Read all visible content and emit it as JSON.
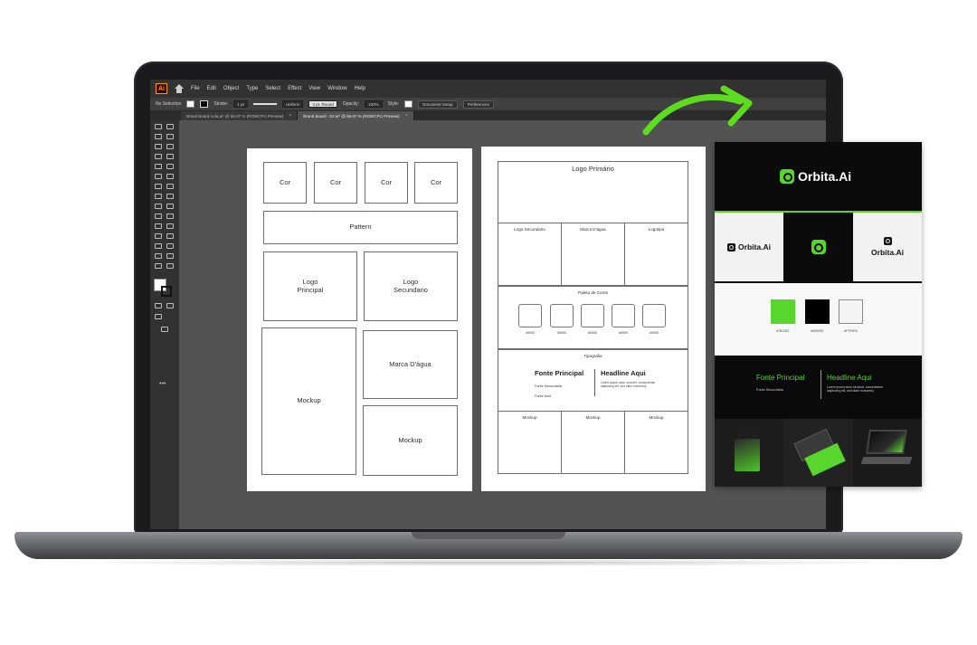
{
  "app": {
    "menu": [
      "File",
      "Edit",
      "Object",
      "Type",
      "Select",
      "Effect",
      "View",
      "Window",
      "Help"
    ],
    "logo_text": "Ai"
  },
  "control_bar": {
    "selection": "No Selection",
    "stroke_label": "Stroke:",
    "stroke_weight": "1 pt",
    "uniform": "Uniform",
    "brush": "3 pt. Round",
    "opacity_label": "Opacity:",
    "opacity_value": "100%",
    "style_label": "Style:",
    "document_setup": "Document Setup",
    "preferences": "Preferences"
  },
  "tabs": [
    {
      "label": "Brand Board Aula.ai* @ 66.67 % (RGB/CPU Preview)",
      "active": false
    },
    {
      "label": "Brand Board - 02.ai* @ 66.67 % (RGB/CPU Preview)",
      "active": true
    }
  ],
  "artboard1": {
    "cor": [
      "Cor",
      "Cor",
      "Cor",
      "Cor"
    ],
    "pattern": "Pattern",
    "logo_principal": "Logo\nPrincipal",
    "logo_secundario": "Logo\nSecundario",
    "mockup_large": "Mockup",
    "marca_dagua": "Marca D'água",
    "mockup_small": "Mockup"
  },
  "artboard2": {
    "logo_primario": "Logo Primário",
    "logo_secundario": "Logo Secundario",
    "marca_dagua": "Marca D'água",
    "logotipo": "Logotipo",
    "paleta": "Paleta de Cores",
    "hexes": [
      "#0000",
      "#0000",
      "#0000",
      "#0000",
      "#0000"
    ],
    "tipografia": "Tipografia",
    "fonte_principal": "Fonte Principal",
    "fonte_secundaria": "Fonte Secundária",
    "fonte_bold": "Fonte bold",
    "headline": "Headline Aqui",
    "body": "Lorem ipsum dolor sit amet, consectetuer adipiscing elit, sed diam nonummy",
    "mockups": [
      "Mockup",
      "Mockup",
      "Mockup"
    ]
  },
  "brand_board": {
    "logo_text": "Orbita.Ai",
    "logo_small_text": "Orbita.Ai",
    "accent_color": "#58d62d",
    "palette": [
      {
        "color": "#58d62d",
        "hex": "#7B1282"
      },
      {
        "color": "#000000",
        "hex": "#000000"
      },
      {
        "color": "#f2f2f2",
        "hex": "#F7F0FA"
      }
    ],
    "fonte_principal": "Fonte Principal",
    "fonte_secundaria": "Fonte Secundária",
    "headline": "Headline Aqui",
    "body": "Lorem ipsum dolor sit amet, consectetuer adipiscing elit, sed diam nonummy"
  }
}
